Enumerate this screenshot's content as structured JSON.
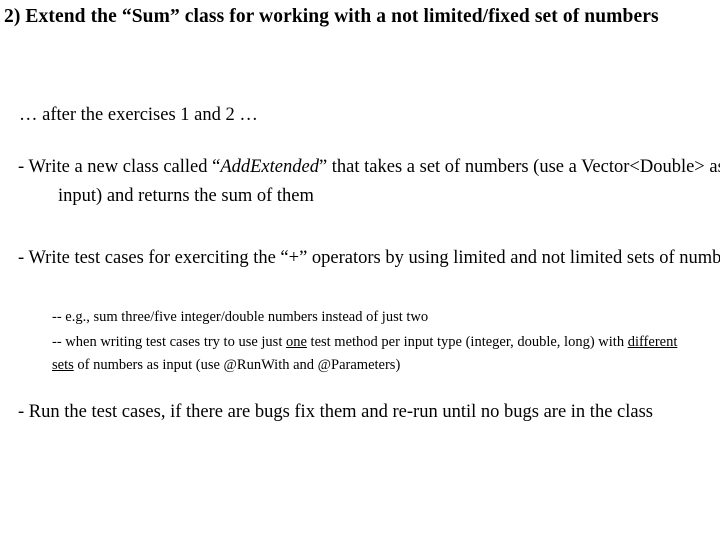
{
  "slide": {
    "title": "2) Extend the “Sum” class for working with a not limited/fixed set of numbers",
    "intro": "… after the exercises 1 and 2 …",
    "bullets": [
      {
        "lead": "- ",
        "text_before": "Write a new class called “",
        "emphasis": "AddExtended",
        "text_after": "” that takes a set of numbers (use a Vector<Double> as input) and returns the sum of them"
      },
      {
        "lead": "- ",
        "text": "Write test cases for exerciting the “+” operators by using limited and not limited sets of numbers"
      }
    ],
    "sub_bullets": [
      {
        "lead": "-- ",
        "text": "e.g., sum three/five integer/double numbers instead of just two"
      },
      {
        "lead": "-- ",
        "part1": "when writing test cases try to use just ",
        "underline1": "one",
        "part2": " test method per input type (integer, double, long) with ",
        "underline2": "different sets",
        "part3": " of numbers as input (use @RunWith and @Parameters)"
      }
    ],
    "final_bullet": {
      "lead": "- ",
      "text": "Run the test cases, if there are bugs fix them and re-run until no bugs are in the class"
    },
    "colors": {
      "background": "#ffffff",
      "text": "#000000"
    }
  }
}
